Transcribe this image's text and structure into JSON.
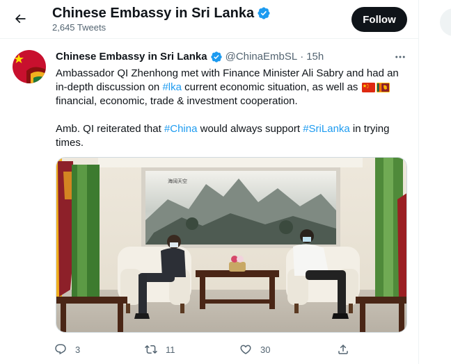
{
  "header": {
    "title": "Chinese Embassy in Sri Lanka",
    "tweet_count": "2,645 Tweets",
    "follow_label": "Follow"
  },
  "tweet": {
    "author_name": "Chinese Embassy in Sri Lanka",
    "handle": "@ChinaEmbSL",
    "separator": "·",
    "time": "15h",
    "p1_part1": "Ambassador QI Zhenhong met with Finance Minister Ali Sabry and had an in-depth discussion on ",
    "p1_tag": "#lka",
    "p1_part2": " current economic situation, as well as ",
    "p1_part3": " financial, economic, trade & investment cooperation.",
    "p2_part1": "Amb. QI reiterated that ",
    "p2_tag1": "#China",
    "p2_part2": " would always support ",
    "p2_tag2": "#SriLanka",
    "p2_part3": " in trying times.",
    "flags": [
      "china-flag-emoji",
      "sri-lanka-flag-emoji"
    ],
    "photo_painting_caption": "海阔天空"
  },
  "actions": {
    "replies": "3",
    "retweets": "11",
    "likes": "30"
  },
  "colors": {
    "accent": "#1d9bf0",
    "text": "#0f1419",
    "muted": "#536471",
    "follow_bg": "#0f1419"
  }
}
